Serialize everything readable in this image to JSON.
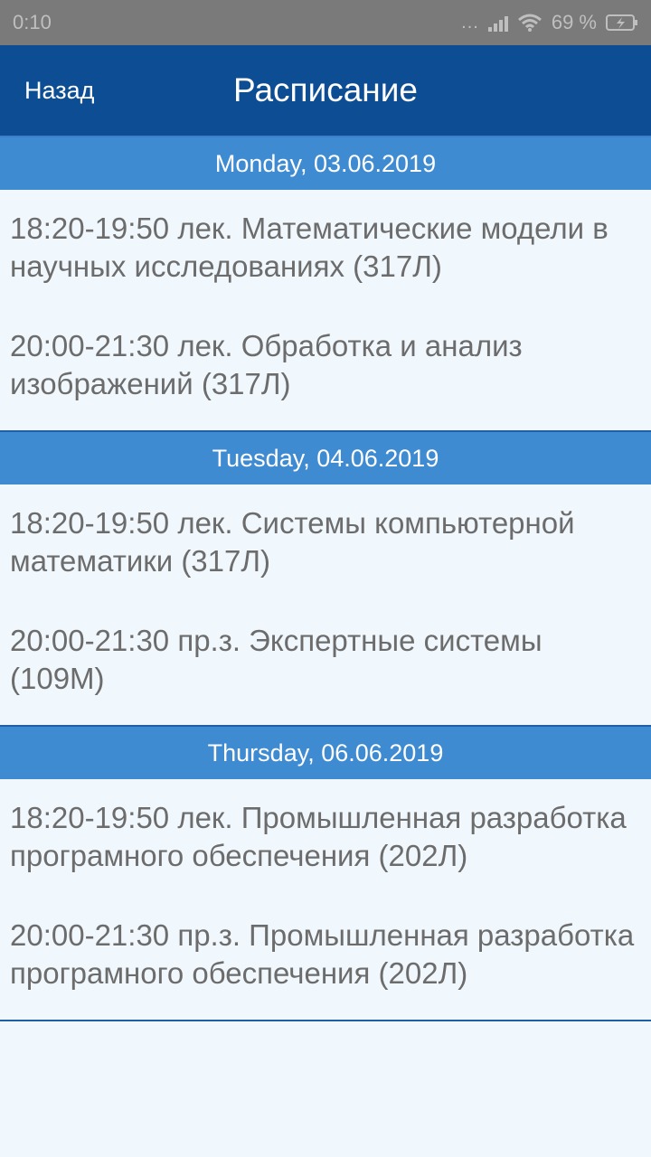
{
  "status_bar": {
    "time": "0:10",
    "dots": "...",
    "battery": "69 %",
    "icons": [
      "signal-icon",
      "wifi-icon",
      "battery-charging-icon"
    ]
  },
  "app_bar": {
    "back_label": "Назад",
    "title": "Расписание",
    "color": "#0c4d93"
  },
  "colors": {
    "day_header": "#3f8bd1",
    "background": "#f1f8fd",
    "lesson_text": "#6c6c6c"
  },
  "days": [
    {
      "header": "Monday, 03.06.2019",
      "lessons": [
        "18:20-19:50 лек. Математические модели в научных исследованиях (317Л)",
        "20:00-21:30 лек. Обработка и анализ изображений (317Л)"
      ]
    },
    {
      "header": "Tuesday, 04.06.2019",
      "lessons": [
        "18:20-19:50 лек. Системы компьютерной математики (317Л)",
        "20:00-21:30 пр.з. Экспертные системы (109М)"
      ]
    },
    {
      "header": "Thursday, 06.06.2019",
      "lessons": [
        "18:20-19:50 лек. Промышленная разработка програмного обеспечения (202Л)",
        "20:00-21:30 пр.з. Промышленная разработка програмного обеспечения (202Л)"
      ]
    }
  ]
}
